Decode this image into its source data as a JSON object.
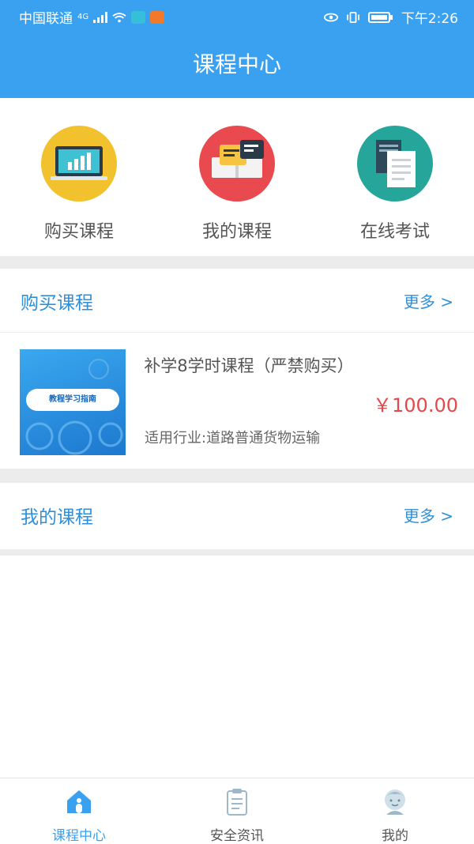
{
  "status_bar": {
    "carrier": "中国联通",
    "network": "4G",
    "time": "下午2:26"
  },
  "header": {
    "title": "课程中心"
  },
  "quick_actions": [
    {
      "label": "购买课程",
      "icon": "laptop-chart-icon",
      "color": "#f2c12e"
    },
    {
      "label": "我的课程",
      "icon": "book-message-icon",
      "color": "#e84a4f"
    },
    {
      "label": "在线考试",
      "icon": "documents-icon",
      "color": "#26a69a"
    }
  ],
  "sections": {
    "buy": {
      "title": "购买课程",
      "more": "更多 >"
    },
    "mine": {
      "title": "我的课程",
      "more": "更多 >"
    }
  },
  "course": {
    "thumbnail_text": "教程学习指南",
    "title": "补学8学时课程（严禁购买）",
    "industry": "适用行业:道路普通货物运输",
    "price": "￥100.00"
  },
  "bottom_nav": [
    {
      "label": "课程中心",
      "icon": "home-icon",
      "active": true
    },
    {
      "label": "安全资讯",
      "icon": "clipboard-icon",
      "active": false
    },
    {
      "label": "我的",
      "icon": "user-avatar-icon",
      "active": false
    }
  ],
  "colors": {
    "primary": "#3aa0f0",
    "price": "#e34a4a",
    "section_title": "#2f8fd8"
  }
}
